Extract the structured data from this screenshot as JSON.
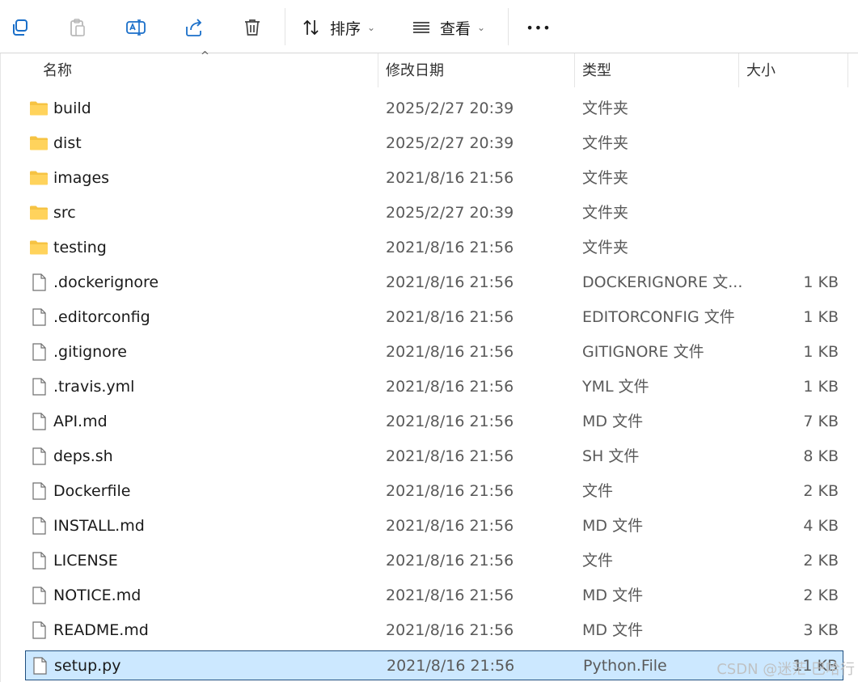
{
  "toolbar": {
    "sort_label": "排序",
    "view_label": "查看",
    "more_label": "•••"
  },
  "columns": {
    "name": "名称",
    "date": "修改日期",
    "type": "类型",
    "size": "大小"
  },
  "files": [
    {
      "icon": "folder-icon",
      "name": "build",
      "date": "2025/2/27 20:39",
      "type": "文件夹",
      "size": ""
    },
    {
      "icon": "folder-icon",
      "name": "dist",
      "date": "2025/2/27 20:39",
      "type": "文件夹",
      "size": ""
    },
    {
      "icon": "folder-icon",
      "name": "images",
      "date": "2021/8/16 21:56",
      "type": "文件夹",
      "size": ""
    },
    {
      "icon": "folder-icon",
      "name": "src",
      "date": "2025/2/27 20:39",
      "type": "文件夹",
      "size": ""
    },
    {
      "icon": "folder-icon",
      "name": "testing",
      "date": "2021/8/16 21:56",
      "type": "文件夹",
      "size": ""
    },
    {
      "icon": "file-icon",
      "name": ".dockerignore",
      "date": "2021/8/16 21:56",
      "type": "DOCKERIGNORE 文...",
      "size": "1 KB"
    },
    {
      "icon": "file-icon",
      "name": ".editorconfig",
      "date": "2021/8/16 21:56",
      "type": "EDITORCONFIG 文件",
      "size": "1 KB"
    },
    {
      "icon": "file-icon",
      "name": ".gitignore",
      "date": "2021/8/16 21:56",
      "type": "GITIGNORE 文件",
      "size": "1 KB"
    },
    {
      "icon": "file-icon",
      "name": ".travis.yml",
      "date": "2021/8/16 21:56",
      "type": "YML 文件",
      "size": "1 KB"
    },
    {
      "icon": "file-icon",
      "name": "API.md",
      "date": "2021/8/16 21:56",
      "type": "MD 文件",
      "size": "7 KB"
    },
    {
      "icon": "file-icon",
      "name": "deps.sh",
      "date": "2021/8/16 21:56",
      "type": "SH 文件",
      "size": "8 KB"
    },
    {
      "icon": "file-icon",
      "name": "Dockerfile",
      "date": "2021/8/16 21:56",
      "type": "文件",
      "size": "2 KB"
    },
    {
      "icon": "file-icon",
      "name": "INSTALL.md",
      "date": "2021/8/16 21:56",
      "type": "MD 文件",
      "size": "4 KB"
    },
    {
      "icon": "file-icon",
      "name": "LICENSE",
      "date": "2021/8/16 21:56",
      "type": "文件",
      "size": "2 KB"
    },
    {
      "icon": "file-icon",
      "name": "NOTICE.md",
      "date": "2021/8/16 21:56",
      "type": "MD 文件",
      "size": "2 KB"
    },
    {
      "icon": "file-icon",
      "name": "README.md",
      "date": "2021/8/16 21:56",
      "type": "MD 文件",
      "size": "3 KB"
    },
    {
      "icon": "file-icon",
      "name": "setup.py",
      "date": "2021/8/16 21:56",
      "type": "Python.File",
      "size": "11 KB",
      "selected": true
    }
  ],
  "watermark": "CSDN @迷茫 巴哈行",
  "colors": {
    "selection_bg": "#cce8ff",
    "selection_border": "#1f4f7f",
    "folder": "#f6c343"
  }
}
